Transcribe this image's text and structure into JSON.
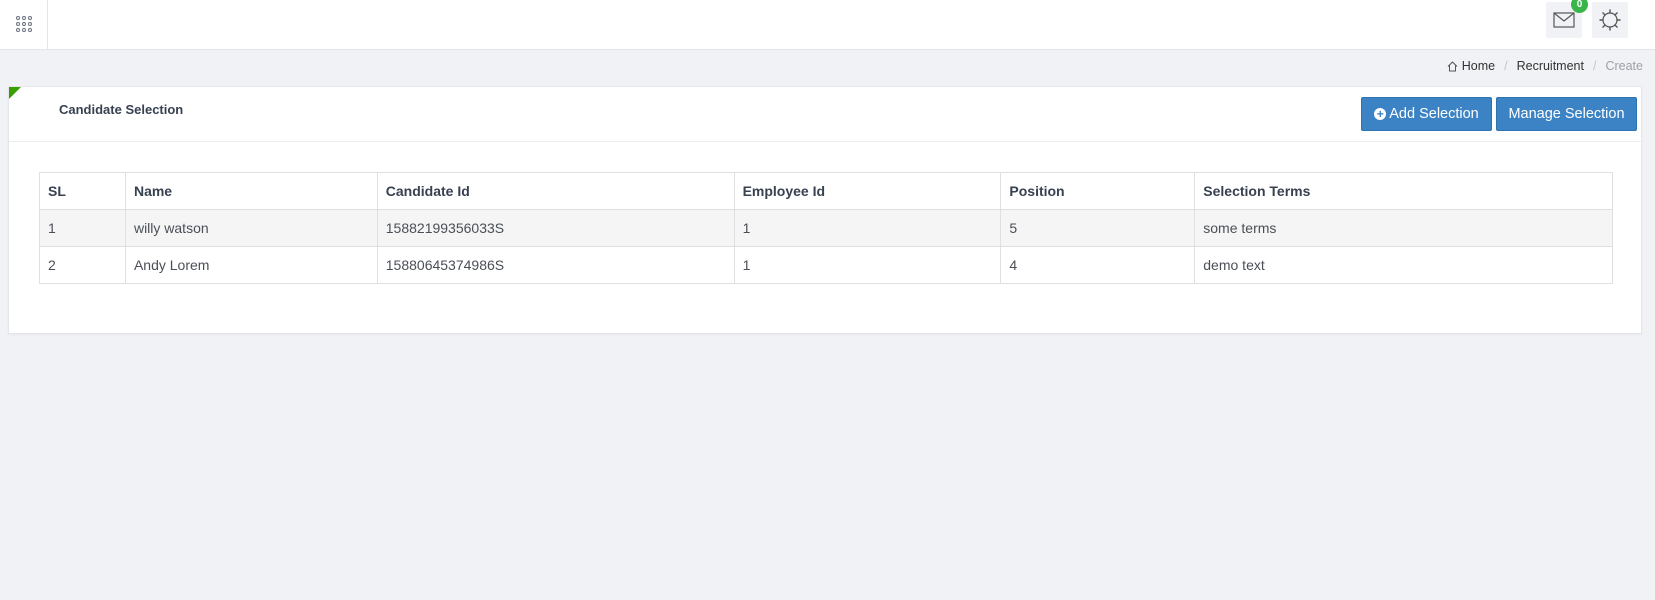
{
  "topbar": {
    "mail_badge": "0"
  },
  "icons": {
    "menu": "grid-menu-icon",
    "mail": "envelope-icon",
    "settings": "gear-icon",
    "home": "home-icon",
    "add": "plus-circle-icon"
  },
  "colors": {
    "primary_button": "#3b83c4",
    "badge": "#3ab54a",
    "corner_accent": "#37a000"
  },
  "breadcrumb": {
    "home": "Home",
    "section": "Recruitment",
    "current": "Create"
  },
  "card": {
    "title": "Candidate Selection",
    "add_button": "Add Selection",
    "manage_button": "Manage Selection"
  },
  "table": {
    "headers": [
      "SL",
      "Name",
      "Candidate Id",
      "Employee Id",
      "Position",
      "Selection Terms"
    ],
    "rows": [
      [
        "1",
        "willy watson",
        "15882199356033S",
        "1",
        "5",
        "some terms"
      ],
      [
        "2",
        "Andy Lorem",
        "15880645374986S",
        "1",
        "4",
        "demo text"
      ]
    ]
  }
}
